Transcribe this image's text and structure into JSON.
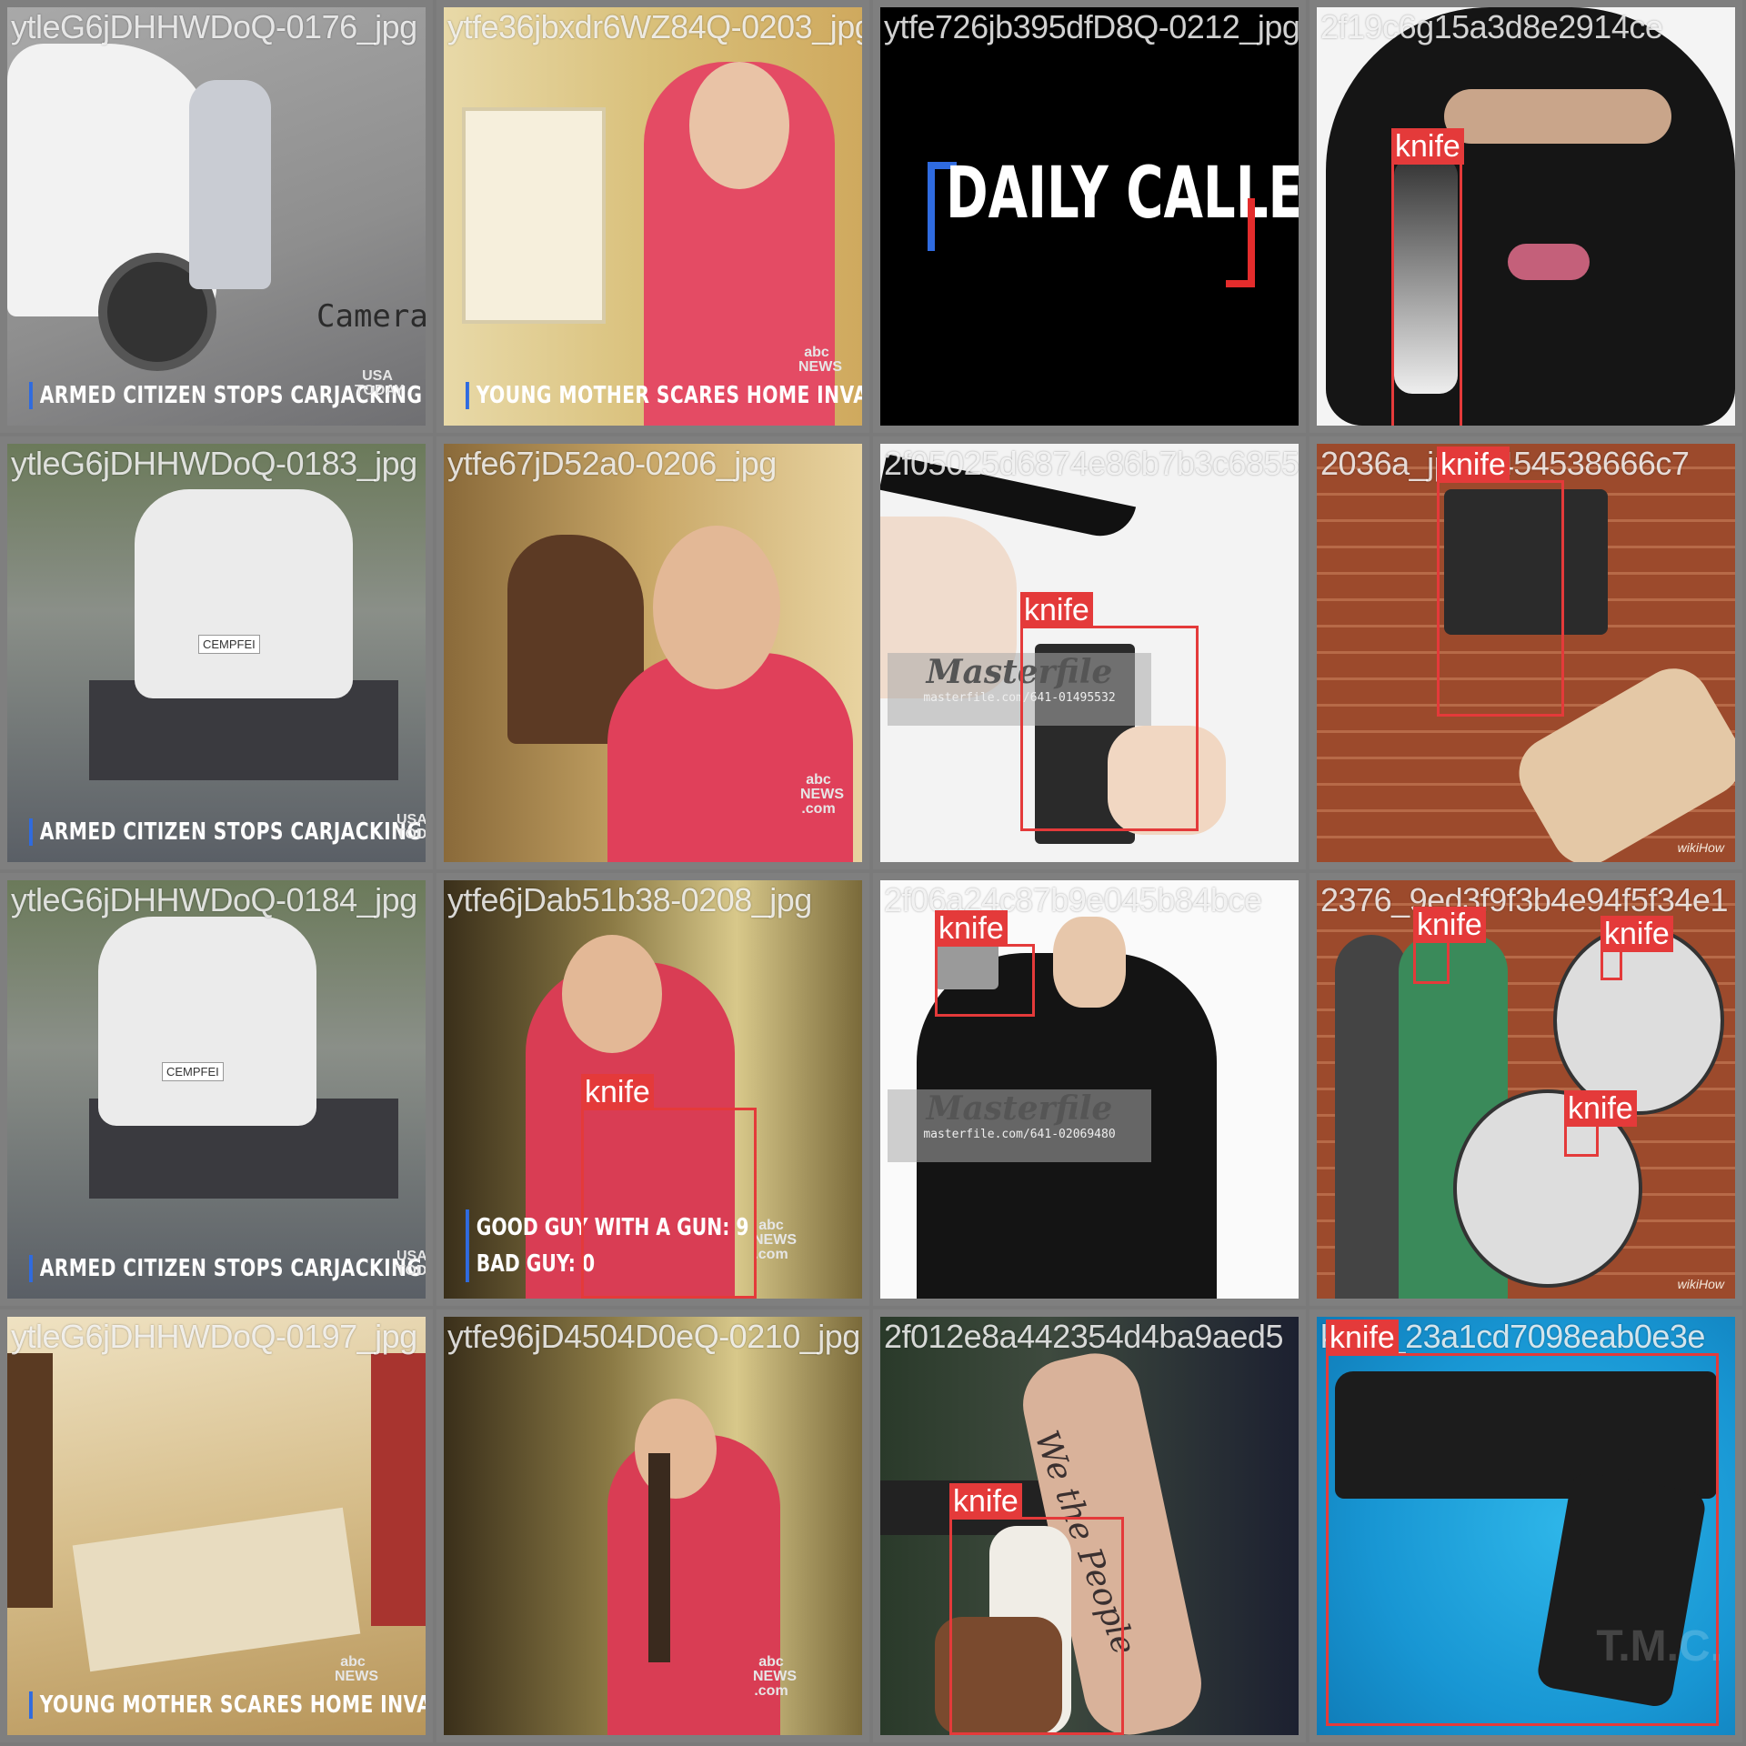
{
  "tiles": [
    {
      "name": "ytleG6jDHHWDoQ-0176_jpg",
      "caption": "ARMED CITIZEN STOPS CARJACKING",
      "bug": "USA TODAY",
      "sign": "Camera"
    },
    {
      "name": "ytfe36jbxdr6WZ84Q-0203_jpg",
      "caption": "YOUNG MOTHER SCARES HOME INVADER OFF",
      "bug": "abc NEWS"
    },
    {
      "name": "ytfe726jb395dfD8Q-0212_jpg",
      "logo": "DAILY CALLER"
    },
    {
      "name": "2f19c6g15a3d8e2914ce",
      "boxes": [
        {
          "label": "knife"
        }
      ]
    },
    {
      "name": "ytleG6jDHHWDoQ-0183_jpg",
      "caption": "ARMED CITIZEN STOPS CARJACKING",
      "bug": "USA TODA",
      "plate": "CEMPFEI"
    },
    {
      "name": "ytfe67jD52a0-0206_jpg",
      "bug": "abc NEWS .com"
    },
    {
      "name": "2f05025d6874e86b7b3c6855",
      "boxes": [
        {
          "label": "knife"
        }
      ],
      "watermark": {
        "brand": "Masterfile",
        "url": "masterfile.com/641-01495532"
      }
    },
    {
      "name": "2036a_jpg.8454538666c7",
      "boxes": [
        {
          "label": "knife"
        }
      ],
      "credit": "wikiHow"
    },
    {
      "name": "ytleG6jDHHWDoQ-0184_jpg",
      "caption": "ARMED CITIZEN STOPS CARJACKING",
      "bug": "USA TODA",
      "plate": "CEMPFEI"
    },
    {
      "name": "ytfe6jDab51b38-0208_jpg",
      "caption_lines": [
        "GOOD GUY WITH A GUN: 9",
        "BAD GUY: 0"
      ],
      "bug": "abc NEWS .com",
      "boxes": [
        {
          "label": "knife"
        }
      ]
    },
    {
      "name": "2f06a24c87b9e045b84bce",
      "boxes": [
        {
          "label": "knife"
        }
      ],
      "watermark": {
        "brand": "Masterfile",
        "url": "masterfile.com/641-02069480"
      }
    },
    {
      "name": "2376_9ed3f9f3b4e94f5f34e1",
      "boxes": [
        {
          "label": "knife"
        },
        {
          "label": "knife"
        },
        {
          "label": "knife"
        }
      ],
      "credit": "wikiHow"
    },
    {
      "name": "ytleG6jDHHWDoQ-0197_jpg",
      "caption": "YOUNG MOTHER SCARES HOME INVADER OFF",
      "bug": "abc NEWS"
    },
    {
      "name": "ytfe96jD4504D0eQ-0210_jpg",
      "bug": "abc NEWS .com"
    },
    {
      "name": "2f012e8a442354d4ba9aed5",
      "boxes": [
        {
          "label": "knife"
        }
      ],
      "tattoo": "We the People"
    },
    {
      "name": "knife_23a1cd7098eab0e3e",
      "boxes": [
        {
          "label": "knife"
        }
      ],
      "mark": "T.M.C."
    }
  ],
  "colors": {
    "box": "#e43a3a",
    "tile_border": "#7f7f7f",
    "caption_bar": "#2f6be0"
  }
}
